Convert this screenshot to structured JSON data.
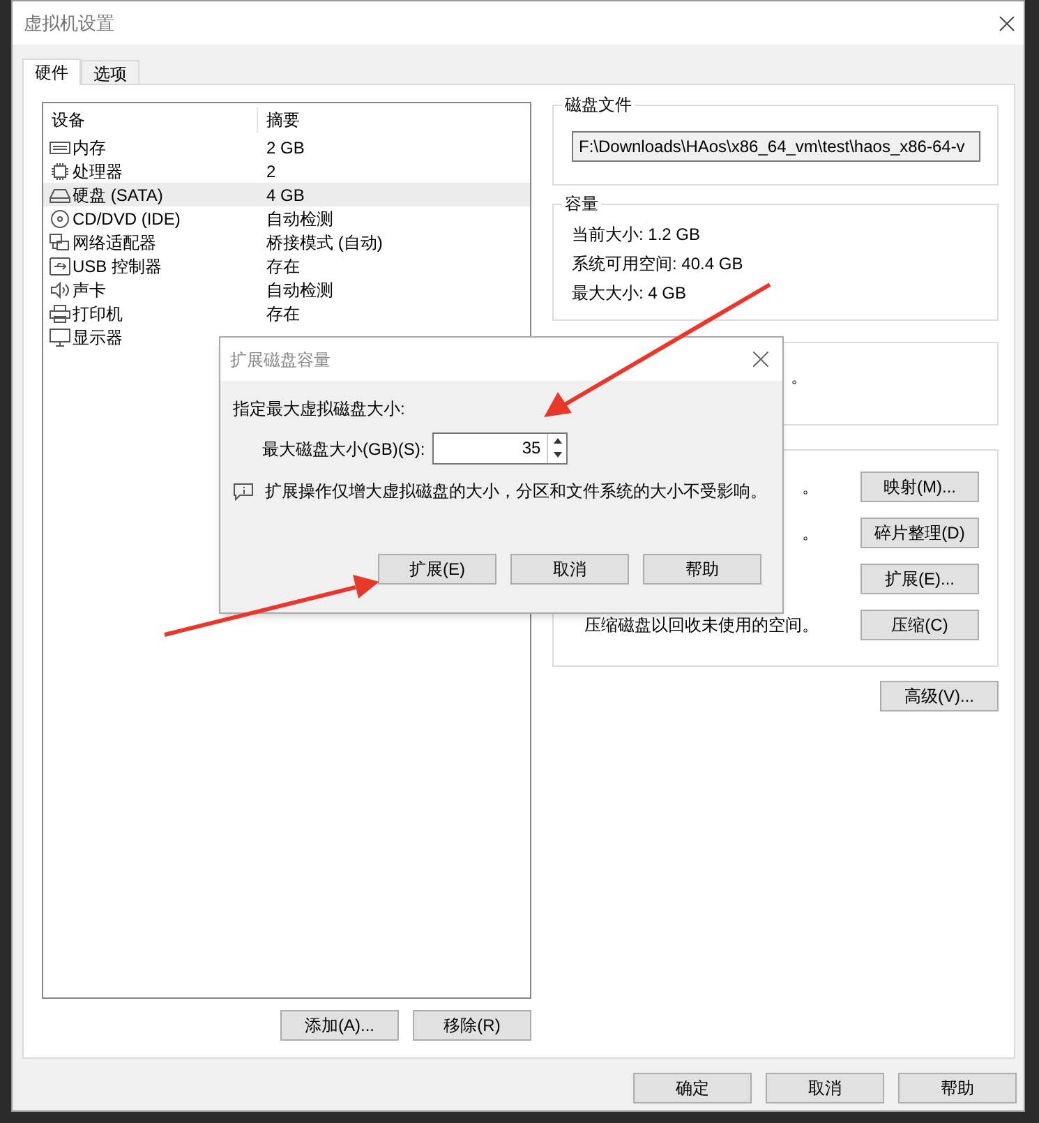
{
  "window": {
    "title": "虚拟机设置"
  },
  "tabs": [
    {
      "label": "硬件",
      "selected": true
    },
    {
      "label": "选项",
      "selected": false
    }
  ],
  "device_table": {
    "columns": [
      "设备",
      "摘要"
    ],
    "rows": [
      {
        "kind": "memory",
        "device": "内存",
        "summary": "2 GB",
        "selected": false
      },
      {
        "kind": "cpu",
        "device": "处理器",
        "summary": "2",
        "selected": false
      },
      {
        "kind": "disk",
        "device": "硬盘 (SATA)",
        "summary": "4 GB",
        "selected": true
      },
      {
        "kind": "cd",
        "device": "CD/DVD (IDE)",
        "summary": "自动检测",
        "selected": false
      },
      {
        "kind": "network",
        "device": "网络适配器",
        "summary": "桥接模式 (自动)",
        "selected": false
      },
      {
        "kind": "usb",
        "device": "USB 控制器",
        "summary": "存在",
        "selected": false
      },
      {
        "kind": "sound",
        "device": "声卡",
        "summary": "自动检测",
        "selected": false
      },
      {
        "kind": "printer",
        "device": "打印机",
        "summary": "存在",
        "selected": false
      },
      {
        "kind": "display",
        "device": "显示器",
        "selected": false
      }
    ]
  },
  "device_buttons": [
    "添加(A)...",
    "移除(R)"
  ],
  "disk_file": {
    "title": "磁盘文件",
    "value": "F:\\Downloads\\HAos\\x86_64_vm\\test\\haos_x86-64-v"
  },
  "capacity": {
    "title": "容量",
    "lines": [
      "当前大小: 1.2 GB",
      "系统可用空间: 40.4 GB",
      "最大大小: 4 GB"
    ]
  },
  "space_group": {
    "fragment": "。"
  },
  "utilities": [
    {
      "text": "。",
      "button": "映射(M)..."
    },
    {
      "text": "。",
      "button": "碎片整理(D)"
    },
    {
      "button": "扩展(E)..."
    },
    {
      "text": "压缩磁盘以回收未使用的空间。",
      "button": "压缩(C)"
    }
  ],
  "advanced_button": "高级(V)...",
  "footer_buttons": [
    "确定",
    "取消",
    "帮助"
  ],
  "dialog": {
    "title": "扩展磁盘容量",
    "prompt": "指定最大虚拟磁盘大小:",
    "size_label": "最大磁盘大小(GB)(S):",
    "size_value": "35",
    "note": "扩展操作仅增大虚拟磁盘的大小，分区和文件系统的大小不受影响。",
    "buttons": [
      "扩展(E)",
      "取消",
      "帮助"
    ]
  }
}
